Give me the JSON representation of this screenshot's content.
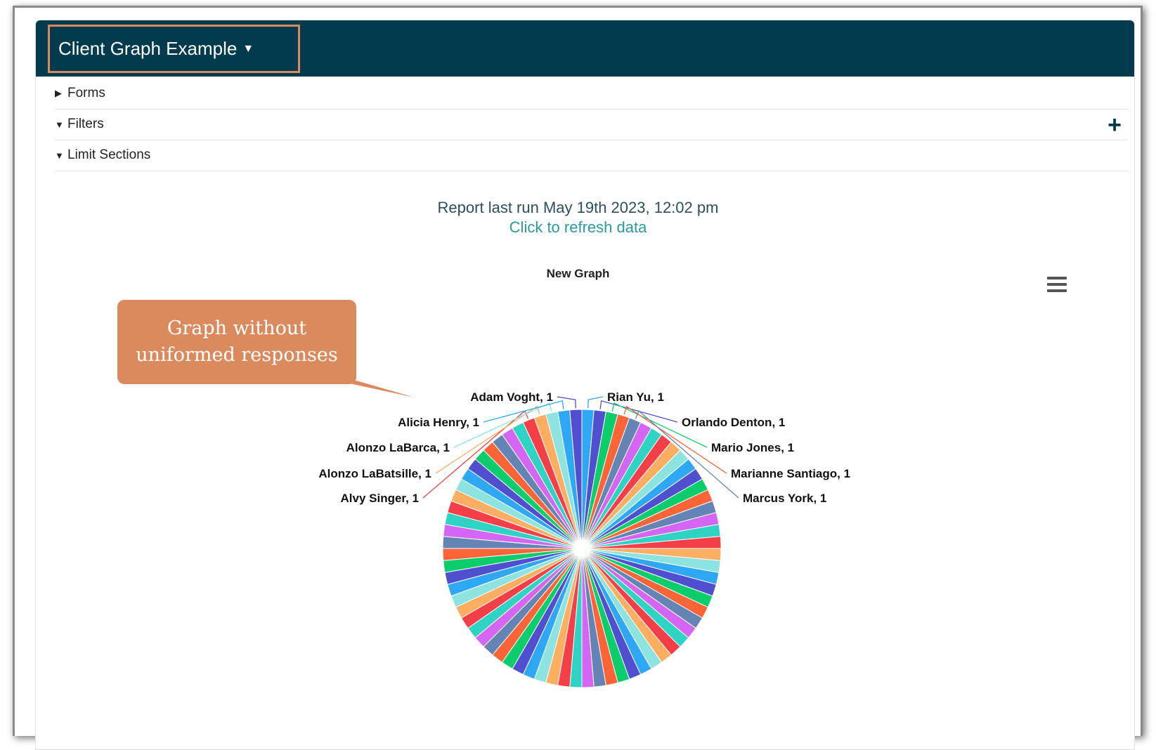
{
  "header": {
    "title": "Client Graph Example"
  },
  "sections": [
    {
      "label": "Forms",
      "expanded": false
    },
    {
      "label": "Filters",
      "expanded": true
    },
    {
      "label": "Limit Sections",
      "expanded": true
    }
  ],
  "report": {
    "last_run": "Report last run May 19th 2023, 12:02 pm",
    "refresh": "Click to refresh data"
  },
  "callout": {
    "line1": "Graph without",
    "line2": "uniformed responses"
  },
  "colors": {
    "header_bg": "#023b4e",
    "title_border": "#d98a5c",
    "callout_bg": "#db8a5d",
    "slice_palette": [
      "#2ea8f5",
      "#4f4fd0",
      "#0ccd6b",
      "#fa6437",
      "#6584b6",
      "#d566f5",
      "#2fd3c4",
      "#f43f48",
      "#fdae60",
      "#8de3e0"
    ]
  },
  "chart_data": {
    "type": "pie",
    "title": "New Graph",
    "slice_count": 72,
    "labels": [
      "Rian Yu, 1",
      "Orlando Denton, 1",
      "Mario Jones, 1",
      "Marianne Santiago, 1",
      "Marcus York, 1",
      "Alvy Singer, 1",
      "Alonzo LaBatsille, 1",
      "Alonzo LaBarca, 1",
      "Alicia Henry, 1",
      "Adam Voght, 1"
    ],
    "values": [
      1,
      1,
      1,
      1,
      1,
      1,
      1,
      1,
      1,
      1
    ]
  }
}
